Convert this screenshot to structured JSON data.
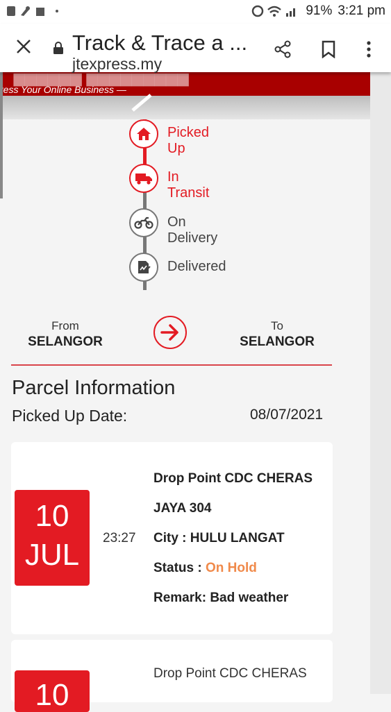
{
  "status_bar": {
    "battery": "91%",
    "time": "3:21 pm"
  },
  "browser": {
    "page_title": "Track & Trace a ...",
    "url": "jtexpress.my"
  },
  "banner": {
    "tagline": "ress Your Online Business —"
  },
  "timeline": {
    "steps": [
      {
        "label": "Picked Up",
        "icon": "home-icon",
        "state": "done"
      },
      {
        "label": "In Transit",
        "icon": "truck-icon",
        "state": "done"
      },
      {
        "label": "On Delivery",
        "icon": "motorcycle-icon",
        "state": "pending"
      },
      {
        "label": "Delivered",
        "icon": "signed-document-icon",
        "state": "pending"
      }
    ]
  },
  "route": {
    "from_label": "From",
    "from_value": "SELANGOR",
    "to_label": "To",
    "to_value": "SELANGOR"
  },
  "parcel": {
    "title": "Parcel Information",
    "picked_up_label": "Picked Up Date:",
    "picked_up_value": "08/07/2021"
  },
  "events": [
    {
      "day": "10",
      "month": "JUL",
      "time": "23:27",
      "drop_point_line1": "Drop Point CDC CHERAS",
      "drop_point_line2": "JAYA 304",
      "city_label": "City :",
      "city": "HULU LANGAT",
      "status_label": "Status :",
      "status": "On Hold",
      "remark_label": "Remark:",
      "remark": "Bad weather"
    },
    {
      "day": "10",
      "drop_point_line1": "Drop Point CDC CHERAS"
    }
  ],
  "colors": {
    "brand_red": "#e31b23",
    "banner_red": "#a80000",
    "status_orange": "#f08a4b"
  }
}
